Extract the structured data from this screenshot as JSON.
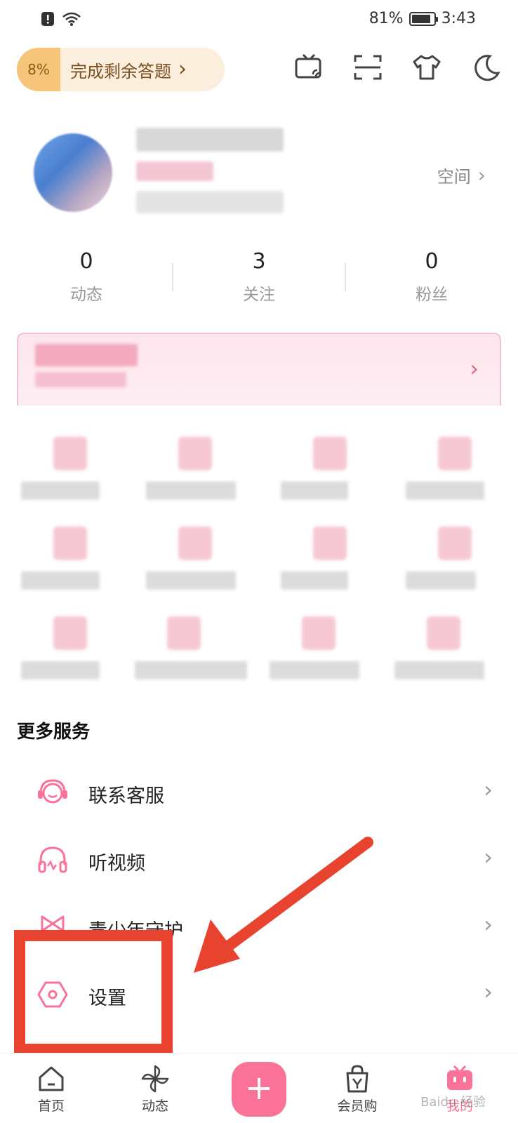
{
  "status_bar": {
    "battery": "81%",
    "battery_level": 0.81,
    "time": "3:43"
  },
  "top_bar": {
    "task_percent": "8%",
    "task_label": "完成剩余答题",
    "icons": [
      "tv-cast-icon",
      "scan-icon",
      "theme-shirt-icon",
      "night-mode-icon"
    ]
  },
  "profile": {
    "space_label": "空间"
  },
  "stats": [
    {
      "count": "0",
      "label": "动态"
    },
    {
      "count": "3",
      "label": "关注"
    },
    {
      "count": "0",
      "label": "粉丝"
    }
  ],
  "more_services": {
    "title": "更多服务",
    "items": [
      {
        "label": "联系客服",
        "icon": "headset-icon"
      },
      {
        "label": "听视频",
        "icon": "headphones-icon"
      },
      {
        "label": "青少年守护",
        "icon": "youth-bow-icon"
      },
      {
        "label": "设置",
        "icon": "settings-hexagon-icon"
      }
    ]
  },
  "bottom_nav": {
    "items": [
      {
        "label": "首页",
        "icon": "home-icon"
      },
      {
        "label": "动态",
        "icon": "pinwheel-icon"
      },
      {
        "label": "会员购",
        "icon": "shopping-bag-icon"
      },
      {
        "label": "我的",
        "icon": "tv-mascot-icon"
      }
    ],
    "plus_label": "+"
  },
  "colors": {
    "accent": "#fb7299",
    "annotation": "#e8432f",
    "task_pill": "#fbeedd"
  },
  "watermark": "Baidu 经验"
}
